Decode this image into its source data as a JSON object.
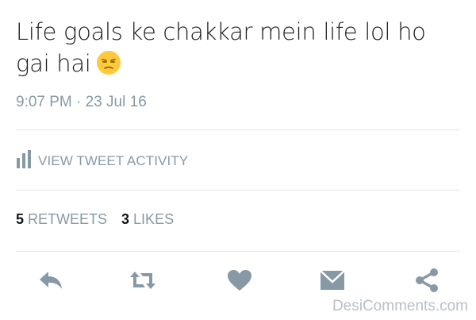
{
  "tweet": {
    "text": "Life goals ke chakkar mein life lol ho gai hai",
    "emoji": "unamused-face-icon",
    "timestamp": "9:07 PM · 23 Jul 16"
  },
  "activity": {
    "label": "VIEW TWEET ACTIVITY",
    "icon": "bar-chart-icon"
  },
  "stats": {
    "retweets_count": "5",
    "retweets_label": "RETWEETS",
    "likes_count": "3",
    "likes_label": "LIKES"
  },
  "actions": [
    "reply-icon",
    "retweet-icon",
    "heart-icon",
    "message-icon",
    "share-icon"
  ],
  "watermark": "DesiComments.com",
  "colors": {
    "icon": "#8899a6",
    "text": "#1c1c1c",
    "muted": "#8899a6",
    "divider": "#e1e8ed",
    "emoji": "#ffc83d"
  }
}
